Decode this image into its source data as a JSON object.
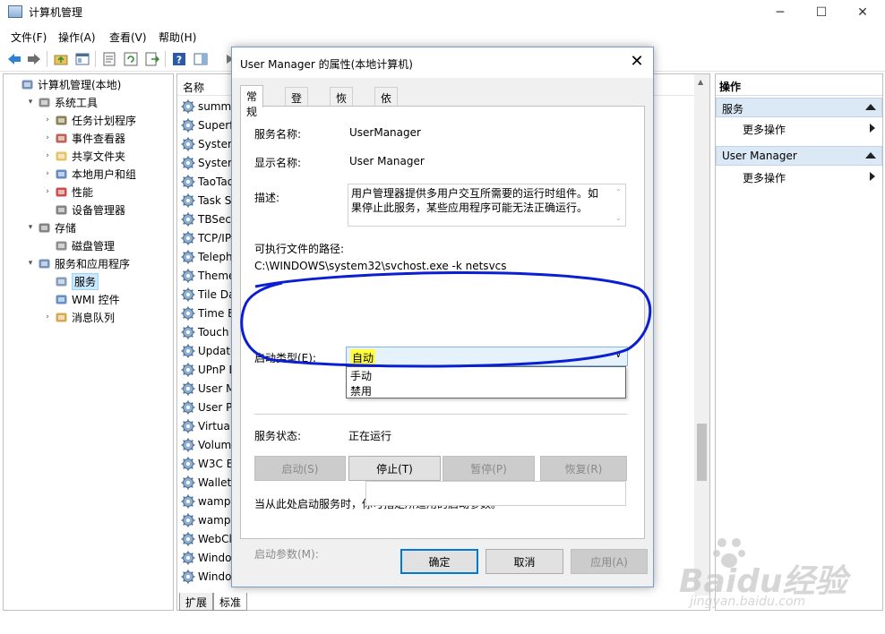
{
  "window": {
    "title": "计算机管理"
  },
  "menu": [
    "文件(F)",
    "操作(A)",
    "查看(V)",
    "帮助(H)"
  ],
  "tree": [
    {
      "label": "计算机管理(本地)",
      "icon": "computer-icon",
      "level": 0,
      "twisty": ""
    },
    {
      "label": "系统工具",
      "icon": "tools-icon",
      "level": 1,
      "twisty": "▾"
    },
    {
      "label": "任务计划程序",
      "icon": "clock-icon",
      "level": 2,
      "twisty": "›"
    },
    {
      "label": "事件查看器",
      "icon": "event-viewer-icon",
      "level": 2,
      "twisty": "›"
    },
    {
      "label": "共享文件夹",
      "icon": "folder-icon",
      "level": 2,
      "twisty": "›"
    },
    {
      "label": "本地用户和组",
      "icon": "users-icon",
      "level": 2,
      "twisty": "›"
    },
    {
      "label": "性能",
      "icon": "performance-icon",
      "level": 2,
      "twisty": "›"
    },
    {
      "label": "设备管理器",
      "icon": "device-manager-icon",
      "level": 2,
      "twisty": ""
    },
    {
      "label": "存储",
      "icon": "storage-icon",
      "level": 1,
      "twisty": "▾"
    },
    {
      "label": "磁盘管理",
      "icon": "disk-icon",
      "level": 2,
      "twisty": ""
    },
    {
      "label": "服务和应用程序",
      "icon": "services-apps-icon",
      "level": 1,
      "twisty": "▾"
    },
    {
      "label": "服务",
      "icon": "gear-icon",
      "level": 2,
      "twisty": "",
      "selected": true
    },
    {
      "label": "WMI 控件",
      "icon": "wmi-icon",
      "level": 2,
      "twisty": ""
    },
    {
      "label": "消息队列",
      "icon": "message-queue-icon",
      "level": 2,
      "twisty": "›"
    }
  ],
  "list": {
    "header": "名称",
    "rows": [
      "summe",
      "Superf",
      "System",
      "System",
      "TaoTao",
      "Task S",
      "TBSecS",
      "TCP/IP",
      "Teleph",
      "Theme",
      "Tile Da",
      "Time B",
      "Touch",
      "Update",
      "UPnP D",
      "User M",
      "User P",
      "Virtual",
      "Volum",
      "W3C E",
      "WalletS",
      "wampa",
      "wampn",
      "WebCl",
      "Windo",
      "Windo"
    ]
  },
  "bottom_tabs": [
    "扩展",
    "标准"
  ],
  "actions": {
    "title": "操作",
    "groups": [
      {
        "name": "服务",
        "item": "更多操作"
      },
      {
        "name": "User Manager",
        "item": "更多操作"
      }
    ]
  },
  "dialog": {
    "title": "User Manager 的属性(本地计算机)",
    "tabs": [
      "常规",
      "登录",
      "恢复",
      "依存关系"
    ],
    "service_name_label": "服务名称:",
    "service_name": "UserManager",
    "display_name_label": "显示名称:",
    "display_name": "User Manager",
    "description_label": "描述:",
    "description": "用户管理器提供多用户交互所需要的运行时组件。如果停止此服务，某些应用程序可能无法正确运行。",
    "exe_path_label": "可执行文件的路径:",
    "exe_path": "C:\\WINDOWS\\system32\\svchost.exe -k netsvcs",
    "startup_type_label": "启动类型(E):",
    "startup_type_value": "自动",
    "startup_options": [
      "手动",
      "禁用"
    ],
    "status_label": "服务状态:",
    "status_value": "正在运行",
    "buttons": {
      "start": "启动(S)",
      "stop": "停止(T)",
      "pause": "暂停(P)",
      "resume": "恢复(R)"
    },
    "hint": "当从此处启动服务时，你可指定所适用的启动参数。",
    "param_label": "启动参数(M):",
    "ok": "确定",
    "cancel": "取消",
    "apply": "应用(A)"
  },
  "watermark": {
    "brand": "Baidu经验",
    "url": "jingyan.baidu.com"
  },
  "colors": {
    "annotation": "#0a1fd1",
    "highlight": "#ffff40",
    "selection": "#cce8ff",
    "action_header": "#dbe8f6"
  }
}
